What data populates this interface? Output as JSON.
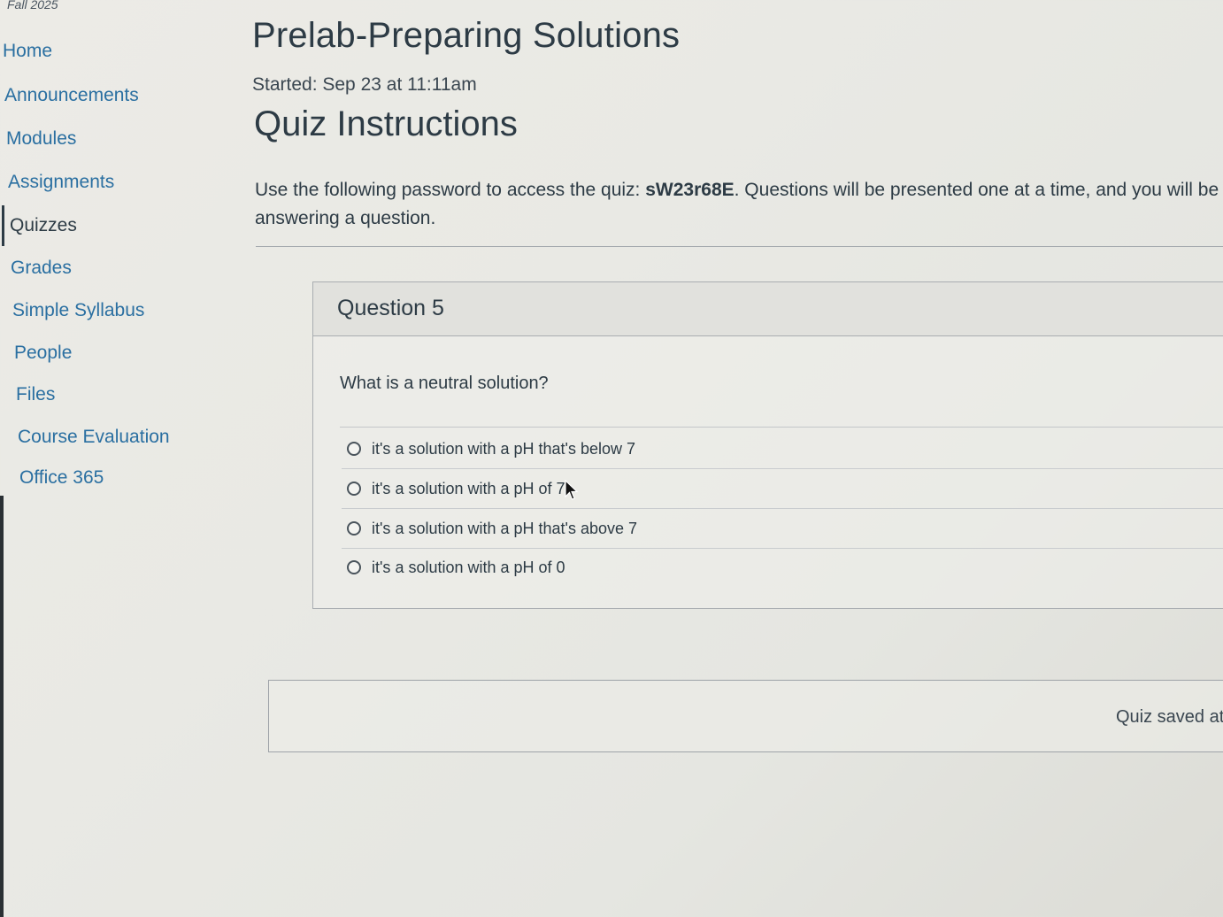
{
  "course": {
    "term": "Fall 2025"
  },
  "nav": {
    "items": [
      {
        "label": "Home"
      },
      {
        "label": "Announcements"
      },
      {
        "label": "Modules"
      },
      {
        "label": "Assignments"
      },
      {
        "label": "Quizzes",
        "active": true
      },
      {
        "label": "Grades"
      },
      {
        "label": "Simple Syllabus"
      },
      {
        "label": "People"
      },
      {
        "label": "Files"
      },
      {
        "label": "Course Evaluation"
      },
      {
        "label": "Office 365"
      }
    ]
  },
  "quiz": {
    "title": "Prelab-Preparing Solutions",
    "started": "Started: Sep 23 at 11:11am",
    "instructions_heading": "Quiz Instructions",
    "instructions_before": "Use the following password to access the quiz: ",
    "password": "sW23r68E",
    "instructions_after": ". Questions will be presented one at a time, and you will be",
    "instructions_line2": "answering a question."
  },
  "question": {
    "title": "Question 5",
    "text": "What is a neutral solution?",
    "answers": [
      {
        "label": "it's a solution with a pH that's below 7"
      },
      {
        "label": "it's a solution with a pH of 7"
      },
      {
        "label": "it's a solution with a pH that's above 7"
      },
      {
        "label": "it's a solution with a pH of 0"
      }
    ]
  },
  "footer": {
    "saved_text": "Quiz saved at"
  },
  "colors": {
    "link": "#2a6fa1",
    "text": "#2d3b45",
    "background": "#ebebe6"
  }
}
